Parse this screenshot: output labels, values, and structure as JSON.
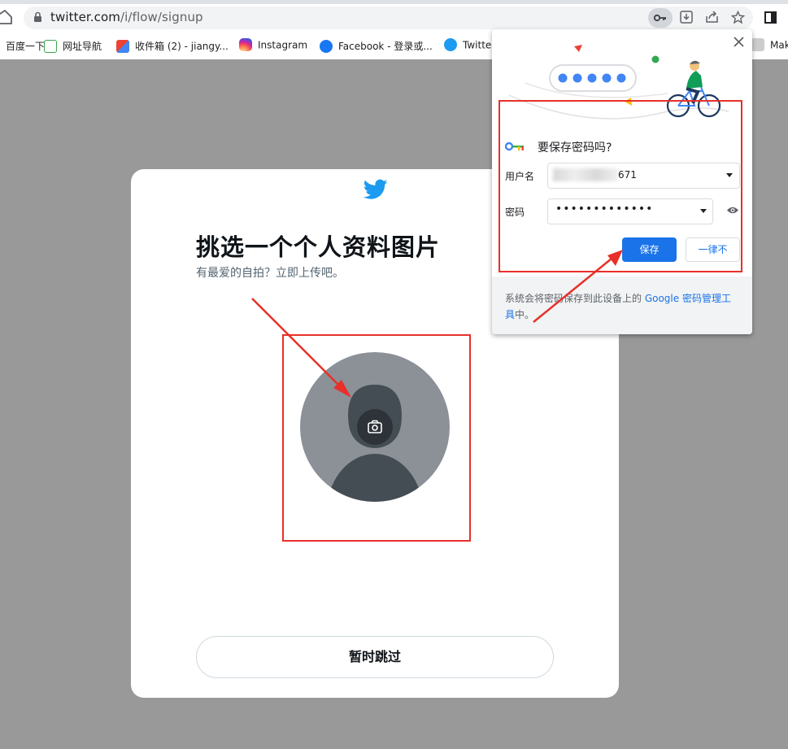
{
  "browser": {
    "url_host": "twitter.com",
    "url_path": "/i/flow/signup",
    "bookmarks": [
      {
        "label": "百度一下",
        "icon": "baidu-icon"
      },
      {
        "label": "网址导航",
        "icon": "2345-nav-icon"
      },
      {
        "label": "收件箱 (2) - jiangy...",
        "icon": "gmail-icon"
      },
      {
        "label": "Instagram",
        "icon": "instagram-icon"
      },
      {
        "label": "Facebook - 登录或...",
        "icon": "facebook-icon"
      },
      {
        "label": "Twitter",
        "icon": "twitter-icon"
      },
      {
        "label": "Make Yo...",
        "icon": "bookmark-icon"
      }
    ]
  },
  "signup": {
    "title": "挑选一个个人资料图片",
    "subtitle": "有最爱的自拍？立即上传吧。",
    "skip_label": "暂时跳过"
  },
  "password_popup": {
    "question": "要保存密码吗?",
    "username_label": "用户名",
    "username_value_visible": "671",
    "password_label": "密码",
    "password_value": "•••••••••••••",
    "save_label": "保存",
    "never_label": "一律不",
    "footer_text": "系统会将密码保存到此设备上的 ",
    "footer_link": "Google 密码管理工具",
    "footer_end": "中。"
  },
  "colors": {
    "accent_blue": "#1a73e8",
    "twitter_blue": "#1d9bf0",
    "annotation_red": "#e8302a",
    "backdrop": "#999999"
  }
}
